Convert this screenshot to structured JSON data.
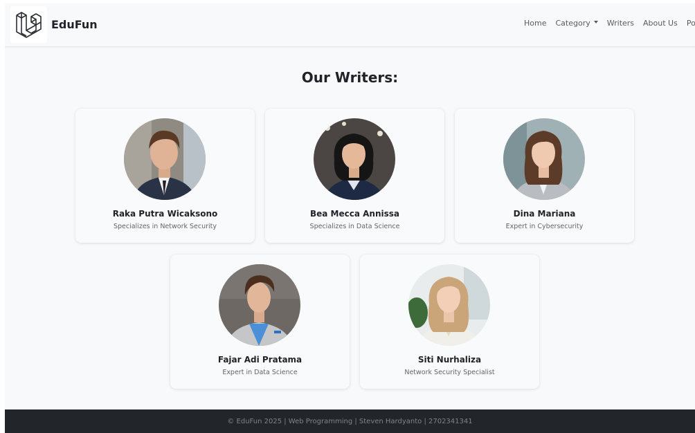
{
  "navbar": {
    "brand": "EduFun",
    "logo_icon": "laravel-logo-icon",
    "links": [
      {
        "label": "Home"
      },
      {
        "label": "Category",
        "dropdown": true
      },
      {
        "label": "Writers"
      },
      {
        "label": "About Us"
      },
      {
        "label": "Popular"
      }
    ]
  },
  "main": {
    "title": "Our Writers:",
    "writers": [
      {
        "name": "Raka Putra Wicaksono",
        "specialty": "Specializes in Network Security",
        "photo": "male-writer-photo"
      },
      {
        "name": "Bea Mecca Annissa",
        "specialty": "Specializes in Data Science",
        "photo": "female-writer-photo"
      },
      {
        "name": "Dina Mariana",
        "specialty": "Expert in Cybersecurity",
        "photo": "female-writer-photo"
      },
      {
        "name": "Fajar Adi Pratama",
        "specialty": "Expert in Data Science",
        "photo": "male-writer-photo"
      },
      {
        "name": "Siti Nurhaliza",
        "specialty": "Network Security Specialist",
        "photo": "female-writer-photo"
      }
    ]
  },
  "footer": {
    "text": "© EduFun 2025 | Web Programming | Steven Hardyanto | 2702341341"
  },
  "colors": {
    "background": "#f8f9fa",
    "footer": "#22262b",
    "text_dark": "#1f2328",
    "text_muted": "#5f656c"
  }
}
